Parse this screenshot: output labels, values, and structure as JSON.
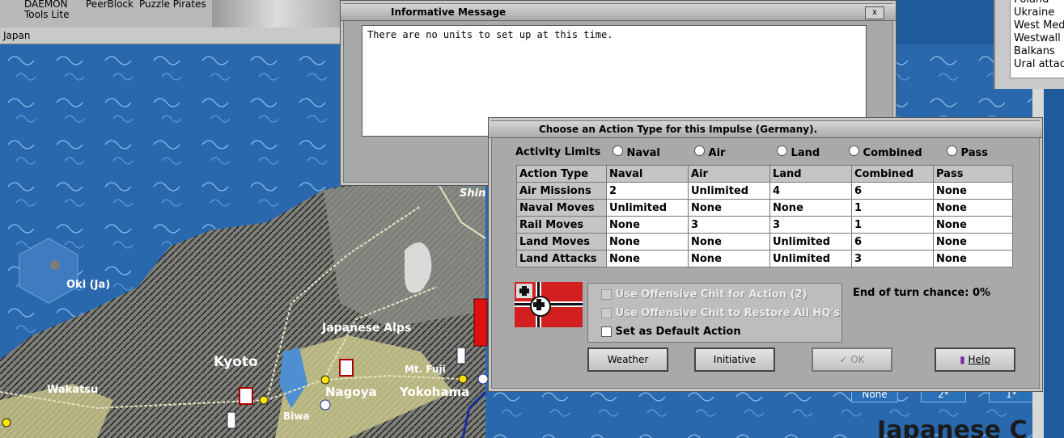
{
  "desktop": {
    "icons": [
      {
        "label": "DAEMON"
      },
      {
        "label": "Tools Lite"
      },
      {
        "label": "PeerBlock"
      },
      {
        "label": "Puzzle Pirates"
      }
    ]
  },
  "map_window": {
    "title": "Japan",
    "labels": {
      "oki": "Oki (Ja)",
      "alps": "Japanese Alps",
      "kyoto": "Kyoto",
      "nagoya": "Nagoya",
      "yokohama": "Yokohama",
      "wakatsu": "Wakatsu",
      "biwa": "Biwa",
      "mtfuji": "Mt. Fuji",
      "shin": "Shin",
      "big": "Japanese C"
    },
    "info_boxes": [
      "None",
      "2*",
      "1*"
    ]
  },
  "side_list": {
    "items": [
      "Poland",
      "Ukraine",
      "West Med",
      "Westwall",
      "Balkans",
      "Ural attac"
    ]
  },
  "message_dialog": {
    "title": "Informative Message",
    "close_glyph": "x",
    "text": "There are no units to set up at this time."
  },
  "action_dialog": {
    "title": "Choose an Action Type for this Impulse (Germany).",
    "activity_limits_label": "Activity Limits",
    "radio_options": [
      "Naval",
      "Air",
      "Land",
      "Combined",
      "Pass"
    ],
    "table": {
      "headers": [
        "Action Type",
        "Naval",
        "Air",
        "Land",
        "Combined",
        "Pass"
      ],
      "rows": [
        [
          "Air Missions",
          "2",
          "Unlimited",
          "4",
          "6",
          "None"
        ],
        [
          "Naval Moves",
          "Unlimited",
          "None",
          "None",
          "1",
          "None"
        ],
        [
          "Rail Moves",
          "None",
          "3",
          "3",
          "1",
          "None"
        ],
        [
          "Land Moves",
          "None",
          "None",
          "Unlimited",
          "6",
          "None"
        ],
        [
          "Land Attacks",
          "None",
          "None",
          "Unlimited",
          "3",
          "None"
        ]
      ]
    },
    "options": {
      "offensive_chit": "Use Offensive Chit for Action (2)",
      "restore_hq": "Use Offensive Chit to Restore All HQ's",
      "default_action": "Set as Default Action"
    },
    "end_of_turn": "End of turn chance: 0%",
    "buttons": {
      "weather": "Weather",
      "initiative": "Initiative",
      "ok": "OK",
      "help": "Help"
    },
    "colors": {
      "flag_red": "#d21f1f",
      "flag_black": "#111111"
    }
  }
}
